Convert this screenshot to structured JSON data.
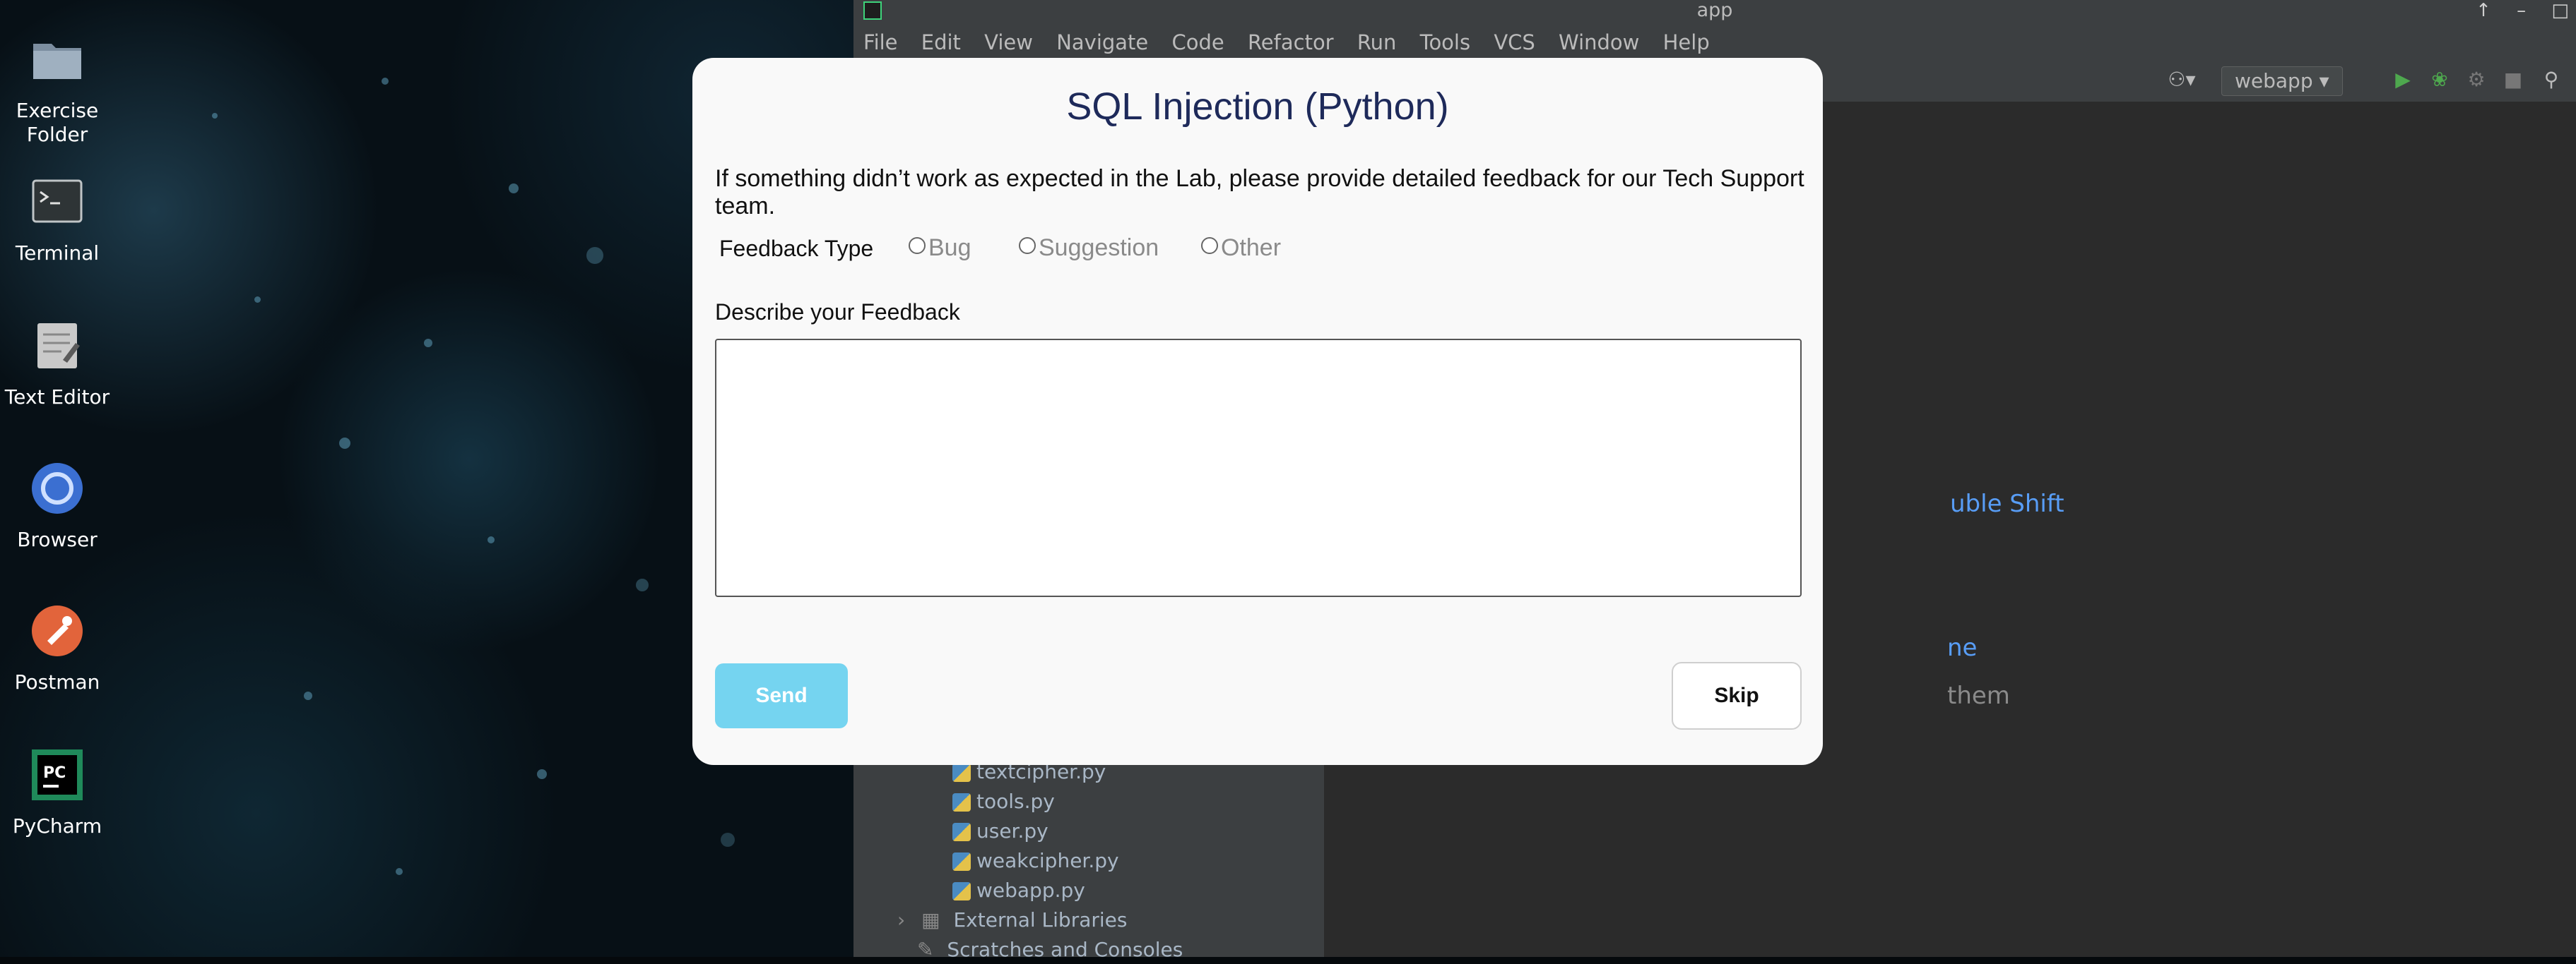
{
  "desktop": {
    "icons": [
      {
        "label": "Exercise\nFolder",
        "icon": "folder-icon"
      },
      {
        "label": "Terminal",
        "icon": "terminal-icon"
      },
      {
        "label": "Text Editor",
        "icon": "text-editor-icon"
      },
      {
        "label": "Browser",
        "icon": "browser-icon"
      },
      {
        "label": "Postman",
        "icon": "postman-icon"
      },
      {
        "label": "PyCharm",
        "icon": "pycharm-icon"
      }
    ]
  },
  "ide": {
    "window_title": "app",
    "window_controls": [
      "↑",
      "–",
      "□"
    ],
    "menu": [
      "File",
      "Edit",
      "View",
      "Navigate",
      "Code",
      "Refactor",
      "Run",
      "Tools",
      "VCS",
      "Window",
      "Help"
    ],
    "run_config": "webapp",
    "project_files": [
      "textcipher.py",
      "tools.py",
      "user.py",
      "weakcipher.py",
      "webapp.py"
    ],
    "external_libraries": "External Libraries",
    "scratches": "Scratches and Consoles",
    "editor_hints": {
      "hint1": "uble Shift",
      "hint2": "ne",
      "hint3": "them"
    }
  },
  "modal": {
    "title": "SQL Injection (Python)",
    "intro": "If something didn’t work as expected in the Lab, please provide detailed feedback for our Tech Support team.",
    "feedback_type_label": "Feedback Type",
    "options": [
      "Bug",
      "Suggestion",
      "Other"
    ],
    "describe_label": "Describe your Feedback",
    "textarea_value": "",
    "send_label": "Send",
    "skip_label": "Skip"
  },
  "colors": {
    "modal_bg": "#f9f9f9",
    "title": "#1e2a5a",
    "send_button": "#75d4f0",
    "ide_bg": "#2b2b2b",
    "ide_chrome": "#3c3f41",
    "link_hint": "#589df6"
  }
}
